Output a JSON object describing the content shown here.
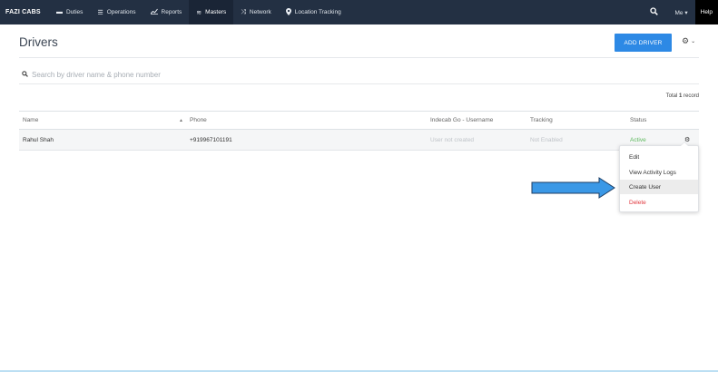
{
  "nav": {
    "brand": "FAZI CABS",
    "items": [
      {
        "label": "Duties",
        "icon": "dash-icon",
        "glyph": "▬"
      },
      {
        "label": "Operations",
        "icon": "list-icon",
        "glyph": "☰"
      },
      {
        "label": "Reports",
        "icon": "chart-icon",
        "glyph": "📈"
      },
      {
        "label": "Masters",
        "icon": "database-icon",
        "glyph": "≋"
      },
      {
        "label": "Network",
        "icon": "shuffle-icon",
        "glyph": "⤨"
      },
      {
        "label": "Location Tracking",
        "icon": "pin-icon",
        "glyph": "⚲"
      }
    ],
    "active_item": "Masters",
    "me_label": "Me ▾",
    "help_label": "Help"
  },
  "page": {
    "title": "Drivers",
    "add_button": "ADD DRIVER"
  },
  "search": {
    "placeholder": "Search by driver name & phone number",
    "value": ""
  },
  "total": {
    "prefix": "Total ",
    "count": "1",
    "suffix": " record"
  },
  "table": {
    "headers": {
      "name": "Name",
      "phone": "Phone",
      "username": "Indecab Go - Username",
      "tracking": "Tracking",
      "status": "Status"
    },
    "rows": [
      {
        "name": "Rahul Shah",
        "phone": "+919967101191",
        "username": "User not created",
        "tracking": "Not Enabled",
        "status": "Active"
      }
    ]
  },
  "dropdown": {
    "items": [
      "Edit",
      "View Activity Logs",
      "Create User",
      "Delete"
    ],
    "highlighted": "Create User"
  },
  "colors": {
    "nav_bg": "#233043",
    "primary": "#2d89e5",
    "arrow": "#3a98e6",
    "active_status": "#5cb85c",
    "danger": "#e0383e"
  }
}
